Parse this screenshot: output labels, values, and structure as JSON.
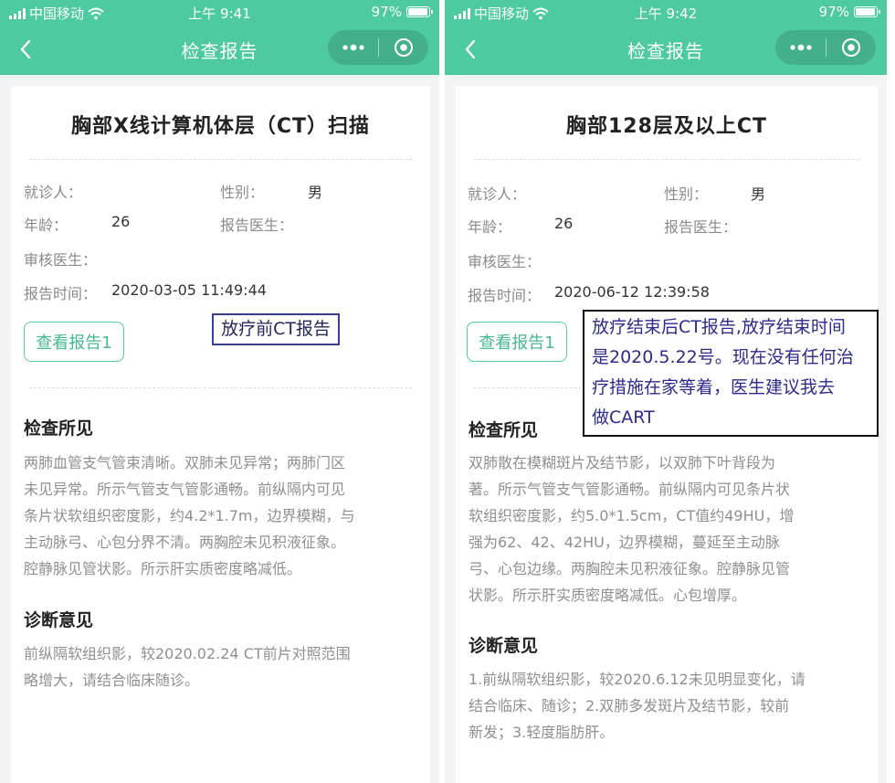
{
  "status_bar": {
    "carrier": "中国移动",
    "battery": "97%",
    "battery_level": 0.97
  },
  "screens": [
    {
      "time": "上午 9:41",
      "nav_title": "检查报告",
      "report_title": "胸部X线计算机体层（CT）扫描",
      "patient_label": "就诊人：",
      "gender_label": "性别：",
      "gender_value": "男",
      "age_label": "年龄：",
      "age_value": "26",
      "doctor_label": "报告医生：",
      "reviewer_label": "审核医生：",
      "time_label": "报告时间：",
      "time_value": "2020-03-05 11:49:44",
      "view_button": "查看报告1",
      "findings_heading": "检查所见",
      "findings_lines": [
        "两肺血管支气管束清晰。双肺未见异常；两肺门区",
        "未见异常。所示气管支气管影通畅。前纵隔内可见",
        "条片状软组织密度影，约4.2*1.7m，边界模糊，与",
        "主动脉弓、心包分界不清。两胸腔未见积液征象。",
        "腔静脉见管状影。所示肝实质密度略减低。"
      ],
      "diagnosis_heading": "诊断意见",
      "diagnosis_lines": [
        "前纵隔软组织影，较2020.02.24 CT前片对照范围",
        "略增大，请结合临床随诊。"
      ]
    },
    {
      "time": "上午 9:42",
      "nav_title": "检查报告",
      "report_title": "胸部128层及以上CT",
      "patient_label": "就诊人：",
      "gender_label": "性别：",
      "gender_value": "男",
      "age_label": "年龄：",
      "age_value": "26",
      "doctor_label": "报告医生：",
      "reviewer_label": "审核医生：",
      "time_label": "报告时间：",
      "time_value": "2020-06-12 12:39:58",
      "view_button": "查看报告1",
      "findings_heading": "检查所见",
      "findings_lines": [
        "双肺散在模糊斑片及结节影，以双肺下叶背段为",
        "著。所示气管支气管影通畅。前纵隔内可见条片状",
        "软组织密度影，约5.0*1.5cm，CT值约49HU，增",
        "强为62、42、42HU，边界模糊，蔓延至主动脉",
        "弓、心包边缘。两胸腔未见积液征象。腔静脉见管",
        "状影。所示肝实质密度略减低。心包增厚。"
      ],
      "diagnosis_heading": "诊断意见",
      "diagnosis_lines": [
        "1.前纵隔软组织影，较2020.6.12未见明显变化，请",
        "结合临床、随诊；2.双肺多发斑片及结节影，较前",
        "新发；3.轻度脂肪肝。"
      ]
    }
  ],
  "annotations": {
    "left_note": "放疗前CT报告",
    "right_note_lines": [
      "放疗结束后CT报告,放疗结束时间",
      "是2020.5.22号。现在没有任何治",
      "疗措施在家等着，医生建议我去",
      "做CART"
    ]
  },
  "colors": {
    "header": "#4ecaa0",
    "button_border": "#56c6a2",
    "note_left_border": "#3a3f8f",
    "note_text": "#2c2a8f"
  }
}
